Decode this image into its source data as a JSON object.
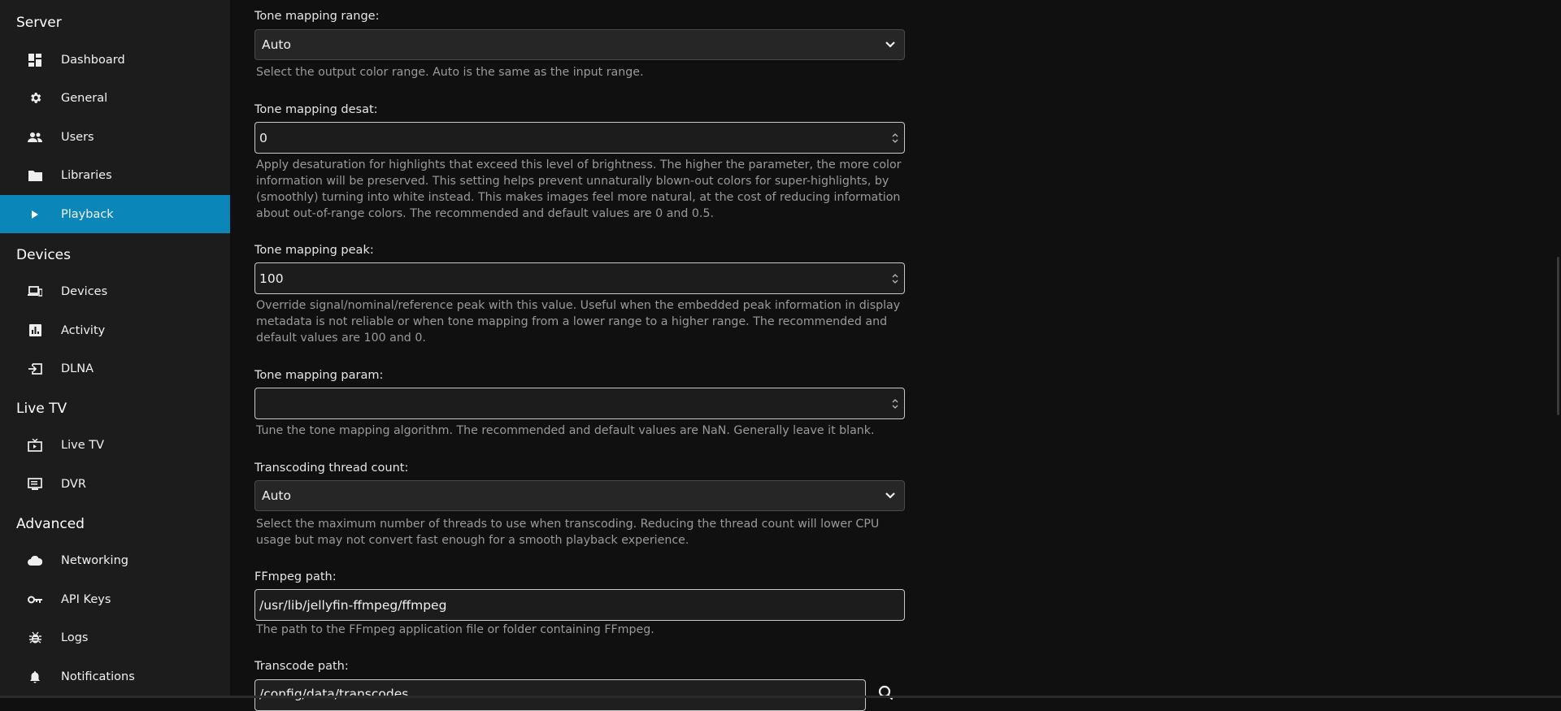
{
  "sidebar": {
    "sections": [
      {
        "title": "Server",
        "items": [
          {
            "label": "Dashboard",
            "icon": "dashboard-icon"
          },
          {
            "label": "General",
            "icon": "gear-icon"
          },
          {
            "label": "Users",
            "icon": "users-icon"
          },
          {
            "label": "Libraries",
            "icon": "folder-icon"
          },
          {
            "label": "Playback",
            "icon": "play-icon",
            "active": true
          }
        ]
      },
      {
        "title": "Devices",
        "items": [
          {
            "label": "Devices",
            "icon": "devices-icon"
          },
          {
            "label": "Activity",
            "icon": "activity-chart-icon"
          },
          {
            "label": "DLNA",
            "icon": "dlna-input-icon"
          }
        ]
      },
      {
        "title": "Live TV",
        "items": [
          {
            "label": "Live TV",
            "icon": "live-tv-icon"
          },
          {
            "label": "DVR",
            "icon": "dvr-icon"
          }
        ]
      },
      {
        "title": "Advanced",
        "items": [
          {
            "label": "Networking",
            "icon": "cloud-icon"
          },
          {
            "label": "API Keys",
            "icon": "key-icon"
          },
          {
            "label": "Logs",
            "icon": "bug-icon"
          },
          {
            "label": "Notifications",
            "icon": "bell-icon"
          }
        ]
      }
    ]
  },
  "fields": {
    "tone_mapping_range": {
      "label": "Tone mapping range:",
      "value": "Auto",
      "help": "Select the output color range. Auto is the same as the input range."
    },
    "tone_mapping_desat": {
      "label": "Tone mapping desat:",
      "value": "0",
      "help": "Apply desaturation for highlights that exceed this level of brightness. The higher the parameter, the more color information will be preserved. This setting helps prevent unnaturally blown-out colors for super-highlights, by (smoothly) turning into white instead. This makes images feel more natural, at the cost of reducing information about out-of-range colors. The recommended and default values are 0 and 0.5."
    },
    "tone_mapping_peak": {
      "label": "Tone mapping peak:",
      "value": "100",
      "help": "Override signal/nominal/reference peak with this value. Useful when the embedded peak information in display metadata is not reliable or when tone mapping from a lower range to a higher range. The recommended and default values are 100 and 0."
    },
    "tone_mapping_param": {
      "label": "Tone mapping param:",
      "value": "",
      "help": "Tune the tone mapping algorithm. The recommended and default values are NaN. Generally leave it blank."
    },
    "transcoding_thread_count": {
      "label": "Transcoding thread count:",
      "value": "Auto",
      "help": "Select the maximum number of threads to use when transcoding. Reducing the thread count will lower CPU usage but may not convert fast enough for a smooth playback experience."
    },
    "ffmpeg_path": {
      "label": "FFmpeg path:",
      "value": "/usr/lib/jellyfin-ffmpeg/ffmpeg",
      "help": "The path to the FFmpeg application file or folder containing FFmpeg."
    },
    "transcode_path": {
      "label": "Transcode path:",
      "value": "/config/data/transcodes"
    }
  }
}
